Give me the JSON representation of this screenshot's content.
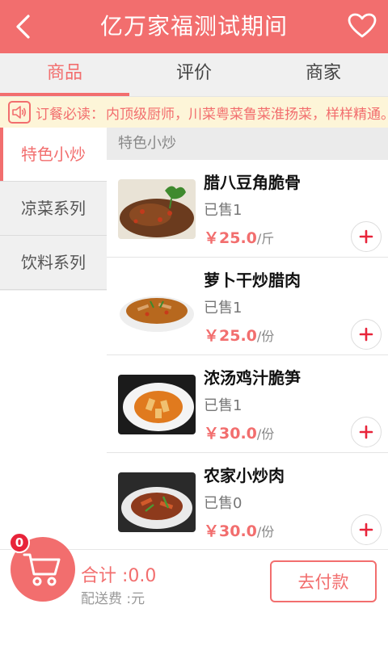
{
  "header": {
    "title": "亿万家福测试期间",
    "back_icon": "back-chevron-icon",
    "favorite_icon": "heart-icon"
  },
  "tabs": [
    {
      "label": "商品",
      "active": true
    },
    {
      "label": "评价",
      "active": false
    },
    {
      "label": "商家",
      "active": false
    }
  ],
  "notice": {
    "icon": "speaker-icon",
    "label": "订餐必读：",
    "text": "内顶级厨师，川菜粤菜鲁菜淮扬菜，样样精通。"
  },
  "sidebar": {
    "categories": [
      {
        "label": "特色小炒",
        "active": true
      },
      {
        "label": "凉菜系列",
        "active": false
      },
      {
        "label": "饮料系列",
        "active": false
      }
    ]
  },
  "menu": {
    "section_title": "特色小炒",
    "items": [
      {
        "name": "腊八豆角脆骨",
        "sold": "已售1",
        "price": "￥25.0",
        "unit": "/斤"
      },
      {
        "name": "萝卜干炒腊肉",
        "sold": "已售1",
        "price": "￥25.0",
        "unit": "/份"
      },
      {
        "name": "浓汤鸡汁脆笋",
        "sold": "已售1",
        "price": "￥30.0",
        "unit": "/份"
      },
      {
        "name": "农家小炒肉",
        "sold": "已售0",
        "price": "￥30.0",
        "unit": "/份"
      }
    ]
  },
  "cart": {
    "icon": "cart-icon",
    "badge_count": "0",
    "total": "合计 :0.0",
    "delivery": "配送费 :元",
    "pay_label": "去付款"
  },
  "colors": {
    "accent": "#f26e6e",
    "badge": "#e8243a",
    "notice_bg": "#fdf5d8"
  }
}
